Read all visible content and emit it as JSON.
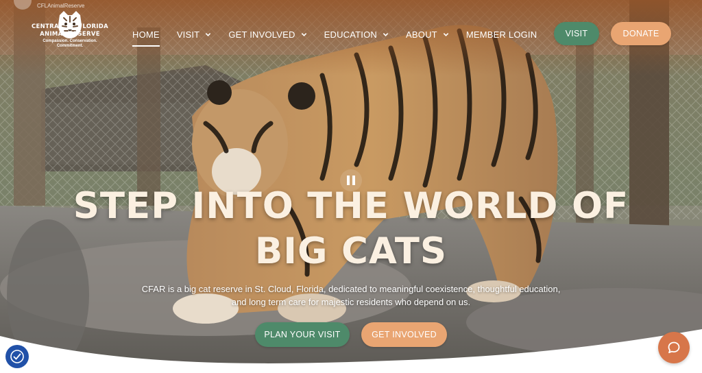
{
  "watermark": {
    "text": "CFLAnimalReserve"
  },
  "logo": {
    "line1_left": "CENTRAL",
    "line1_right": "FLORIDA",
    "line2": "ANIMAL RESERVE",
    "tagline_1": "Compassion. Conservation.",
    "tagline_2": "Commitment."
  },
  "nav": {
    "items": [
      {
        "label": "HOME",
        "active": true,
        "dropdown": false
      },
      {
        "label": "VISIT",
        "dropdown": true
      },
      {
        "label": "GET INVOLVED",
        "dropdown": true
      },
      {
        "label": "EDUCATION",
        "dropdown": true
      },
      {
        "label": "ABOUT",
        "dropdown": true
      },
      {
        "label": "MEMBER LOGIN",
        "dropdown": false
      }
    ],
    "visit_button": "VISIT",
    "donate_button": "DONATE"
  },
  "hero": {
    "headline_line1": "STEP INTO THE WORLD OF",
    "headline_line2": "BIG CATS",
    "description_line1": "CFAR is a big cat reserve in St. Cloud, Florida, dedicated to meaningful coexistence, thoughtful education,",
    "description_line2": "and long term care for majestic residents who depend on us.",
    "primary_button": "PLAN YOUR VISIT",
    "secondary_button": "GET INVOLVED",
    "video_control_icon": "pause-icon"
  },
  "widgets": {
    "accessibility_icon": "accessibility-icon",
    "chat_icon": "chat-bubble-icon"
  },
  "colors": {
    "green": "#4e8a6a",
    "orange": "#e9a572",
    "chat": "#d7764a",
    "headline": "#fbf0e1",
    "accessibility": "#2151a8"
  }
}
